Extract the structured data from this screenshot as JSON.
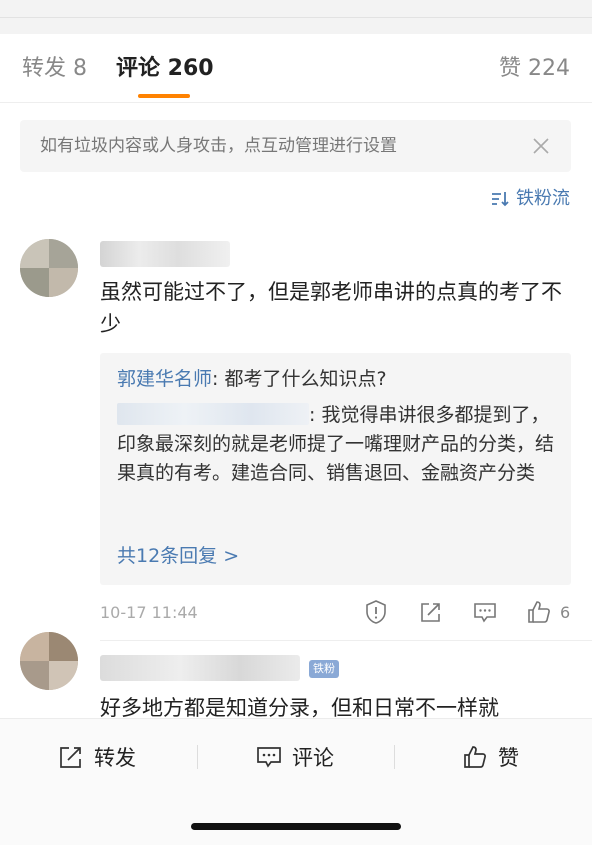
{
  "tabs": {
    "repost": "转发 8",
    "comment": "评论 260",
    "like": "赞 224"
  },
  "notice": {
    "text": "如有垃圾内容或人身攻击，点互动管理进行设置"
  },
  "sort": {
    "label": "铁粉流"
  },
  "comments": [
    {
      "text": "虽然可能过不了，但是郭老师串讲的点真的考了不少",
      "replies": [
        {
          "author": "郭建华名师",
          "text": ": 都考了什么知识点?"
        },
        {
          "text": ": 我觉得串讲很多都提到了，印象最深刻的就是老师提了一嘴理财产品的分类，结果真的有考。建造合同、销售退回、金融资产分类"
        }
      ],
      "more_replies": "共12条回复 >",
      "time": "10-17 11:44",
      "like_count": "6"
    },
    {
      "badge": "铁粉",
      "text": "好多地方都是知道分录，但和日常不一样就"
    }
  ],
  "bottom_bar": {
    "repost": "转发",
    "comment": "评论",
    "like": "赞"
  },
  "colors": {
    "accent": "#ff8200",
    "link": "#4a7ab1"
  }
}
